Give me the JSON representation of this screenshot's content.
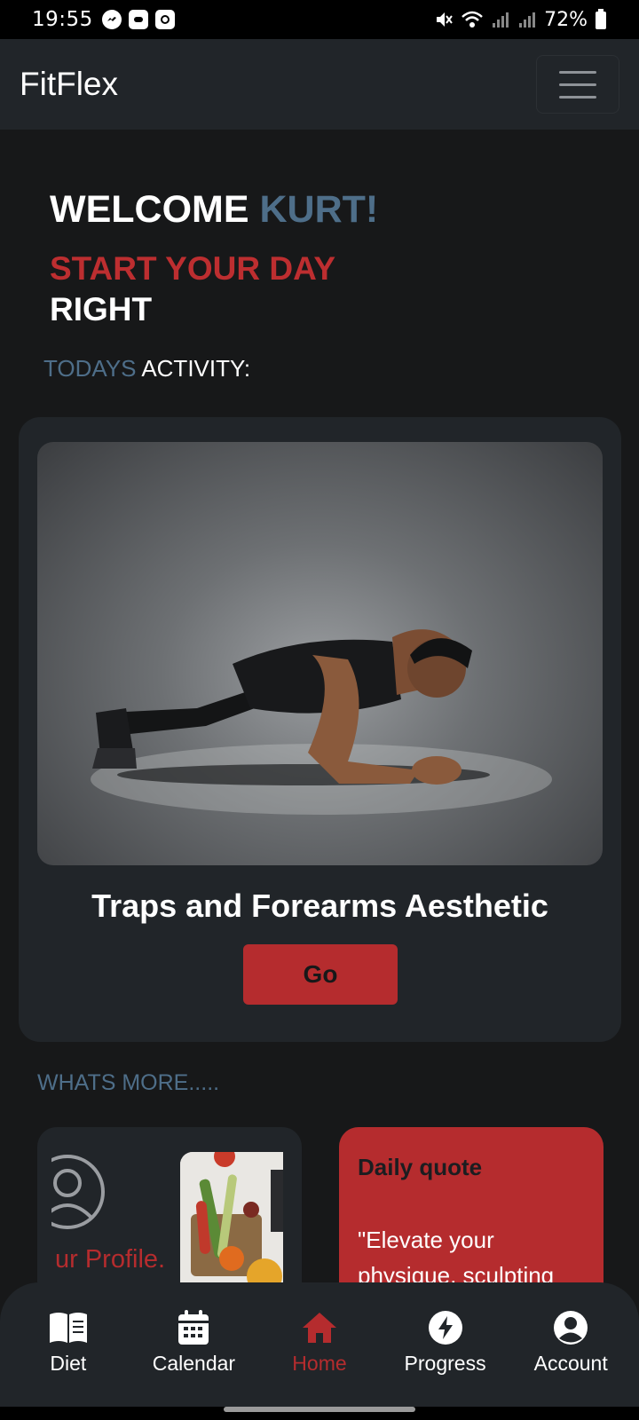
{
  "status_bar": {
    "time": "19:55",
    "battery": "72%"
  },
  "navbar": {
    "brand": "FitFlex"
  },
  "hero": {
    "welcome": "WELCOME",
    "user_name": "KURT!",
    "tagline_red": "START YOUR DAY",
    "tagline_white": "RIGHT",
    "today_prefix": "TODAYS",
    "today_suffix": "ACTIVITY:"
  },
  "activity": {
    "title": "Traps and Forearms Aesthetic",
    "button": "Go"
  },
  "whats_more": "WHATS MORE.....",
  "profile_card": {
    "text": "ur Profile."
  },
  "quote_card": {
    "title": "Daily quote",
    "text": "\"Elevate your physique, sculpting"
  },
  "bottom_nav": [
    {
      "label": "Diet",
      "icon": "book-icon",
      "active": false
    },
    {
      "label": "Calendar",
      "icon": "calendar-icon",
      "active": false
    },
    {
      "label": "Home",
      "icon": "home-icon",
      "active": true
    },
    {
      "label": "Progress",
      "icon": "bolt-icon",
      "active": false
    },
    {
      "label": "Account",
      "icon": "user-circle-icon",
      "active": false
    }
  ],
  "colors": {
    "accent_red": "#b52c2e",
    "accent_blue": "#4e6e89",
    "background": "#171819",
    "card": "#212529"
  }
}
